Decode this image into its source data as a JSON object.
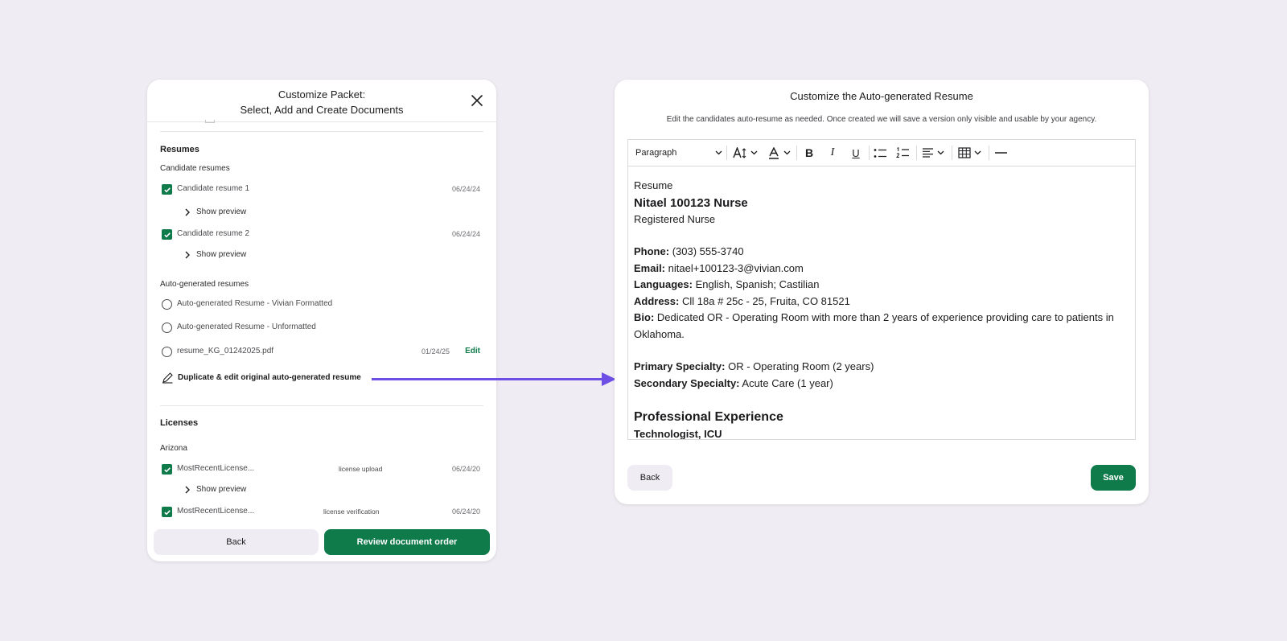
{
  "packet": {
    "title_line1": "Customize Packet:",
    "title_line2": "Select, Add and Create Documents",
    "resumes": {
      "heading": "Resumes",
      "candidate_heading": "Candidate resumes",
      "candidate": [
        {
          "label": "Candidate resume 1",
          "date": "06/24/24",
          "checked": true,
          "preview": "Show preview"
        },
        {
          "label": "Candidate resume 2",
          "date": "06/24/24",
          "checked": true,
          "preview": "Show preview"
        }
      ],
      "auto_heading": "Auto-generated resumes",
      "auto": [
        {
          "label": "Auto-generated Resume - Vivian Formatted"
        },
        {
          "label": "Auto-generated Resume - Unformatted"
        },
        {
          "label": "resume_KG_01242025.pdf",
          "date": "01/24/25",
          "edit": "Edit"
        }
      ],
      "duplicate_label": "Duplicate & edit original auto-generated resume"
    },
    "licenses": {
      "heading": "Licenses",
      "state": "Arizona",
      "items": [
        {
          "label": "MostRecentLicense...",
          "tag": "license upload",
          "date": "06/24/20",
          "checked": true,
          "preview": "Show preview"
        },
        {
          "label": "MostRecentLicense...",
          "tag": "license verification",
          "date": "06/24/20",
          "checked": true
        }
      ]
    },
    "back_label": "Back",
    "review_label": "Review document order"
  },
  "editor": {
    "title": "Customize the Auto-generated Resume",
    "description": "Edit the candidates auto-resume as needed. Once created we will save a version only visible and usable by your agency.",
    "toolbar": {
      "paragraph": "Paragraph",
      "icons": [
        "font-size-icon",
        "font-color-icon",
        "bold-icon",
        "italic-icon",
        "underline-icon",
        "bullet-list-icon",
        "numbered-list-icon",
        "align-icon",
        "table-icon",
        "horizontal-rule-icon"
      ]
    },
    "doc": {
      "label": "Resume",
      "name": "Nitael 100123 Nurse",
      "role": "Registered Nurse",
      "phone_label": "Phone:",
      "phone": "(303) 555-3740",
      "email_label": "Email:",
      "email": "nitael+100123-3@vivian.com",
      "languages_label": "Languages:",
      "languages": "English, Spanish; Castilian",
      "address_label": "Address:",
      "address": "Cll 18a # 25c - 25, Fruita, CO 81521",
      "bio_label": "Bio:",
      "bio": "Dedicated OR - Operating Room with more than 2 years of experience providing care to patients in Oklahoma.",
      "primary_label": "Primary Specialty:",
      "primary": "OR - Operating Room (2 years)",
      "secondary_label": "Secondary Specialty:",
      "secondary": "Acute Care (1 year)",
      "experience_heading": "Professional Experience",
      "first_job": "Technologist, ICU"
    },
    "back_label": "Back",
    "save_label": "Save"
  },
  "colors": {
    "background": "#efedf3",
    "primary_green": "#0f7a4a",
    "arrow": "#6d4fe6",
    "secondary_button": "#efedf3"
  }
}
